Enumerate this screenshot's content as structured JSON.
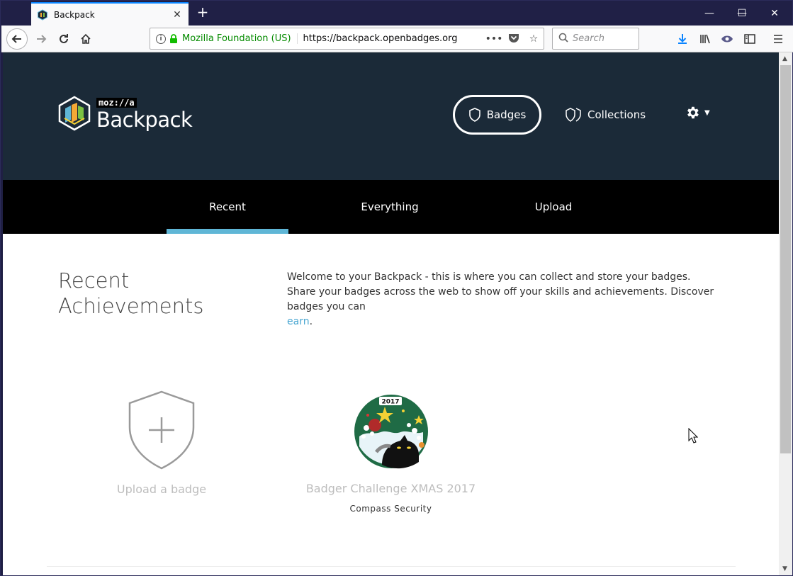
{
  "browser": {
    "tab_title": "Backpack",
    "tab_close": "✕",
    "new_tab": "+",
    "identity": "Mozilla Foundation (US)",
    "url": "https://backpack.openbadges.org",
    "search_placeholder": "Search",
    "window_controls": {
      "minimize": "—",
      "maximize": "☐",
      "close": "✕"
    }
  },
  "site": {
    "logo_mozilla": "moz://a",
    "logo_brand": "Backpack",
    "nav": {
      "badges": "Badges",
      "collections": "Collections"
    }
  },
  "subnav": {
    "tabs": [
      {
        "label": "Recent",
        "active": true
      },
      {
        "label": "Everything",
        "active": false
      },
      {
        "label": "Upload",
        "active": false
      }
    ]
  },
  "content": {
    "title_line1": "Recent",
    "title_line2": "Achievements",
    "welcome_text": "Welcome to your Backpack - this is where you can collect and store your badges. Share your badges across the web to show off your skills and achievements. Discover badges you can",
    "welcome_link": "earn",
    "welcome_end": "."
  },
  "badges": [
    {
      "label": "Upload a badge"
    },
    {
      "label": "Badger Challenge XMAS 2017",
      "issuer": "Compass Security",
      "year": "2017"
    }
  ],
  "colors": {
    "header_bg": "#1b2a38",
    "subnav_bg": "#000000",
    "active_tab": "#5fb6d6",
    "link": "#4aa7d2",
    "identity_green": "#058b00"
  }
}
